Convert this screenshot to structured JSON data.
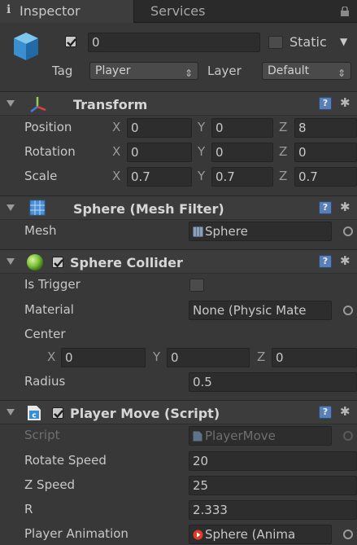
{
  "tabs": {
    "inspector": "Inspector",
    "services": "Services"
  },
  "object": {
    "active_checked": true,
    "name": "0",
    "static_label": "Static",
    "tag_label": "Tag",
    "tag_value": "Player",
    "layer_label": "Layer",
    "layer_value": "Default"
  },
  "transform": {
    "title": "Transform",
    "position": {
      "label": "Position",
      "x": "0",
      "y": "0",
      "z": "8"
    },
    "rotation": {
      "label": "Rotation",
      "x": "0",
      "y": "0",
      "z": "0"
    },
    "scale": {
      "label": "Scale",
      "x": "0.7",
      "y": "0.7",
      "z": "0.7"
    }
  },
  "axes": {
    "x": "X",
    "y": "Y",
    "z": "Z"
  },
  "mesh_filter": {
    "title": "Sphere (Mesh Filter)",
    "mesh_label": "Mesh",
    "mesh_value": "Sphere"
  },
  "sphere_collider": {
    "title": "Sphere Collider",
    "is_trigger_label": "Is Trigger",
    "material_label": "Material",
    "material_value": "None (Physic Mate",
    "center_label": "Center",
    "center": {
      "x": "0",
      "y": "0",
      "z": "0"
    },
    "radius_label": "Radius",
    "radius_value": "0.5"
  },
  "player_move": {
    "title": "Player Move (Script)",
    "script_label": "Script",
    "script_value": "PlayerMove",
    "rotate_speed_label": "Rotate Speed",
    "rotate_speed_value": "20",
    "z_speed_label": "Z Speed",
    "z_speed_value": "25",
    "r_label": "R",
    "r_value": "2.333",
    "player_animation_label": "Player Animation",
    "player_animation_value": "Sphere (Anima"
  },
  "colors": {
    "accent_help": "#5a7fb5",
    "panel_bg": "#383838",
    "field_bg": "#2d2d2d"
  }
}
